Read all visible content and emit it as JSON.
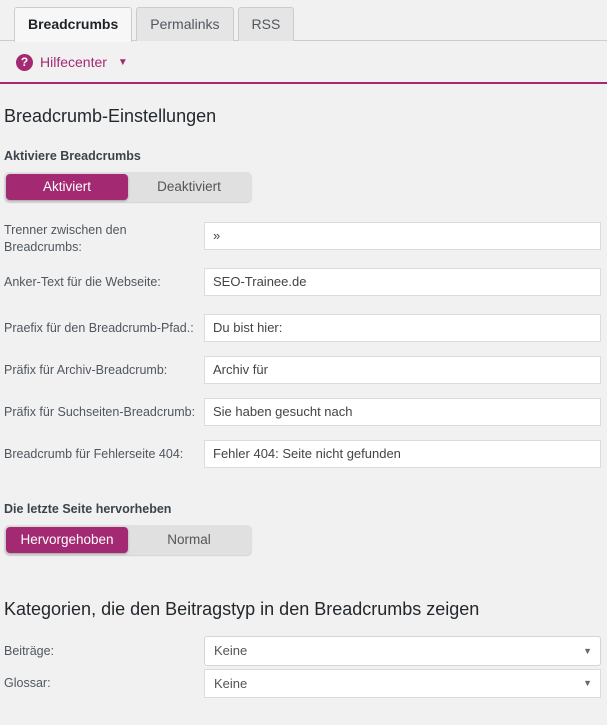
{
  "tabs": [
    {
      "label": "Breadcrumbs",
      "active": true
    },
    {
      "label": "Permalinks",
      "active": false
    },
    {
      "label": "RSS",
      "active": false
    }
  ],
  "help": {
    "icon": "question-mark-circle-icon",
    "icon_glyph": "?",
    "label": "Hilfecenter",
    "caret": "▼"
  },
  "section": {
    "title": "Breadcrumb-Einstellungen",
    "enable_label": "Aktiviere Breadcrumbs",
    "enable_toggle": {
      "on_label": "Aktiviert",
      "off_label": "Deaktiviert",
      "selected": "Aktiviert"
    }
  },
  "fields": [
    {
      "label": "Trenner zwischen den Breadcrumbs:",
      "value": "»",
      "multiline_label": true
    },
    {
      "label": "Anker-Text für die Webseite:",
      "value": "SEO-Trainee.de",
      "multiline_label": false
    },
    {
      "label": "Praefix für den Breadcrumb-Pfad.:",
      "value": "Du bist hier:",
      "multiline_label": false
    },
    {
      "label": "Präfix für Archiv-Breadcrumb:",
      "value": "Archiv für",
      "multiline_label": false
    },
    {
      "label": "Präfix für Suchseiten-Breadcrumb:",
      "value": "Sie haben gesucht nach",
      "multiline_label": false
    },
    {
      "label": "Breadcrumb für Fehlerseite 404:",
      "value": "Fehler 404: Seite nicht gefunden",
      "multiline_label": false
    }
  ],
  "highlight": {
    "label": "Die letzte Seite hervorheben",
    "toggle": {
      "on_label": "Hervorgehoben",
      "off_label": "Normal",
      "selected": "Hervorgehoben"
    }
  },
  "categories": {
    "title": "Kategorien, die den Beitragstyp in den Breadcrumbs zeigen",
    "rows": [
      {
        "label": "Beiträge:",
        "value": "Keine",
        "caret": "▼"
      },
      {
        "label": "Glossar:",
        "value": "Keine",
        "caret": "▼"
      }
    ]
  },
  "colors": {
    "accent": "#a32a72",
    "page_bg": "#f1f1f1",
    "label_text": "#50575e"
  }
}
